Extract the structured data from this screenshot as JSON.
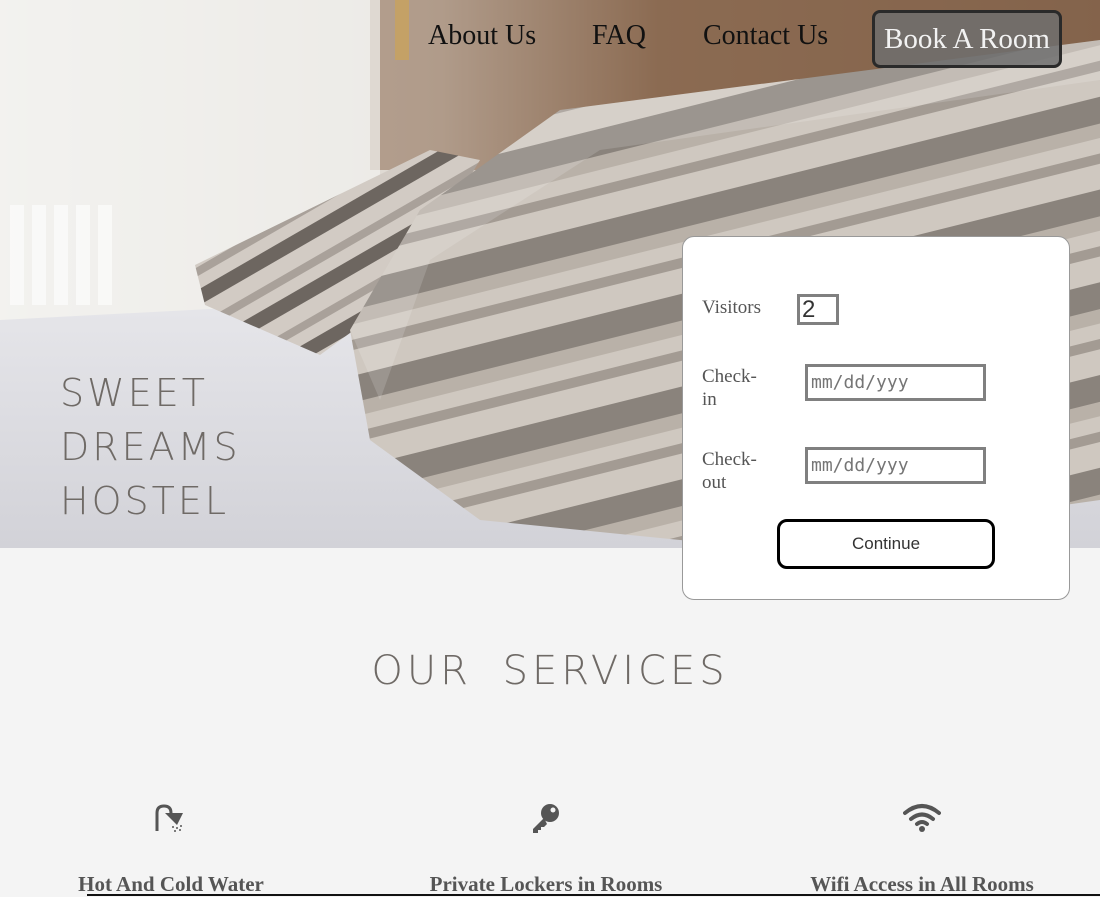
{
  "nav": {
    "links": [
      "About Us",
      "FAQ",
      "Contact Us"
    ],
    "book_label": "Book A Room"
  },
  "brand": {
    "lines": [
      "SWEET",
      "DREAMS",
      "HOSTEL"
    ]
  },
  "booking": {
    "visitors_label": "Visitors",
    "visitors_value": "2",
    "checkin_label": "Check-in",
    "checkout_label": "Check-out",
    "date_placeholder": "mm/dd/yyy",
    "continue_label": "Continue"
  },
  "services": {
    "title": "OUR SERVICES",
    "items": [
      {
        "icon": "shower-icon",
        "label": "Hot And Cold Water"
      },
      {
        "icon": "key-icon",
        "label": "Private Lockers in Rooms"
      },
      {
        "icon": "wifi-icon",
        "label": "Wifi Access in All Rooms"
      }
    ]
  },
  "colors": {
    "accent_text": "#6f6a66",
    "page_bg": "#f4f4f4",
    "button_bg": "#6e6e6e"
  }
}
